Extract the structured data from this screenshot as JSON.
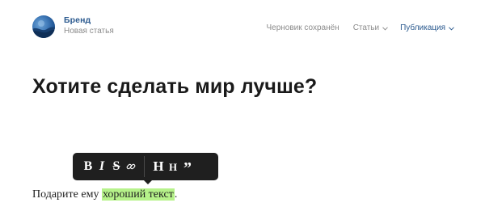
{
  "header": {
    "brand_name": "Бренд",
    "brand_subtitle": "Новая статья",
    "draft_status": "Черновик сохранён",
    "articles_label": "Статьи",
    "publish_label": "Публикация"
  },
  "editor": {
    "title": "Хотите сделать мир лучше?",
    "paragraph_before": "Подарите ему ",
    "paragraph_highlight": "хороший текст",
    "paragraph_after": "."
  },
  "toolbar": {
    "bold": "B",
    "italic": "I",
    "strike": "S",
    "heading_large": "H",
    "heading_small": "H",
    "quote": "”"
  },
  "colors": {
    "brand": "#2b5a8f",
    "muted": "#8c8c8c",
    "toolbar_bg": "#1f1f1f",
    "highlight": "#b6f28a"
  },
  "icons": {
    "avatar": "brand-logo-icon",
    "link": "link-icon",
    "dropdown": "chevron-down-icon"
  }
}
